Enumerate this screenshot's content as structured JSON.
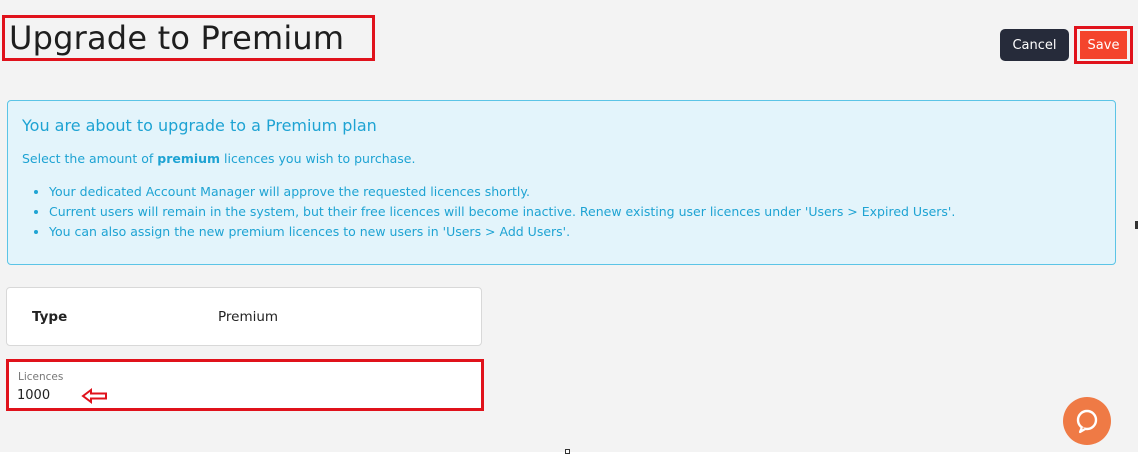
{
  "page": {
    "title": "Upgrade to Premium"
  },
  "actions": {
    "cancel_label": "Cancel",
    "save_label": "Save"
  },
  "info": {
    "heading": "You are about to upgrade to a Premium plan",
    "desc_prefix": "Select the amount of ",
    "desc_bold": "premium",
    "desc_suffix": " licences you wish to purchase.",
    "bullets": [
      "Your dedicated Account Manager will approve the requested licences shortly.",
      "Current users will remain in the system, but their free licences will become inactive. Renew existing user licences under 'Users > Expired Users'.",
      "You can also assign the new premium licences to new users in 'Users > Add Users'."
    ]
  },
  "type_card": {
    "label": "Type",
    "value": "Premium"
  },
  "licences": {
    "label": "Licences",
    "value": "1000"
  },
  "colors": {
    "annotation_red": "#e0121b",
    "save_orange": "#f4442c",
    "cancel_dark": "#262b3a",
    "info_blue": "#1ea3d3",
    "help_orange": "#ef7a45"
  },
  "icons": {
    "arrow": "left-arrow-icon",
    "help": "chat-help-icon"
  }
}
